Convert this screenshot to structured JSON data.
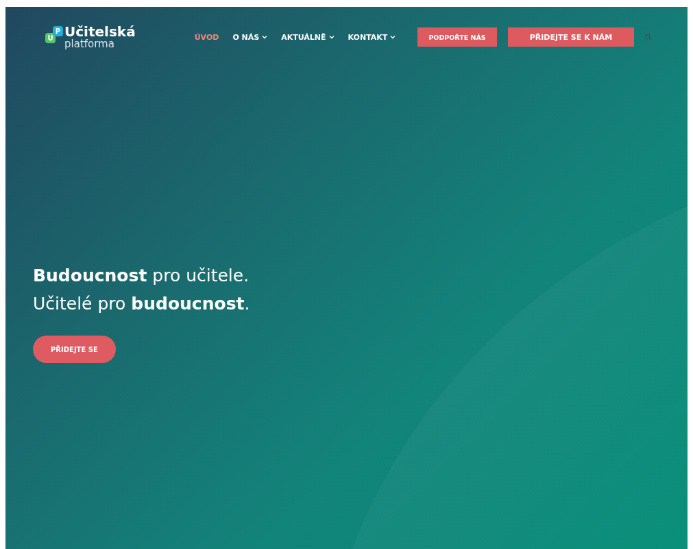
{
  "logo": {
    "badges": [
      "U",
      "P"
    ],
    "title": "Učitelská",
    "subtitle": "platforma"
  },
  "nav": [
    {
      "label": "ÚVOD",
      "selected": true,
      "dropdown": false
    },
    {
      "label": "O NÁS",
      "selected": false,
      "dropdown": true
    },
    {
      "label": "AKTUÁLNĚ",
      "selected": false,
      "dropdown": true
    },
    {
      "label": "KONTAKT",
      "selected": false,
      "dropdown": true
    }
  ],
  "actions": [
    "PODPOŘTE NÁS",
    "PŘIDEJTE SE K NÁM"
  ],
  "hero": {
    "lines": [
      "**Budoucnost** pro učitele.",
      "Učitelé pro **budoucnost**."
    ],
    "button": "PŘIDEJTE SE"
  }
}
